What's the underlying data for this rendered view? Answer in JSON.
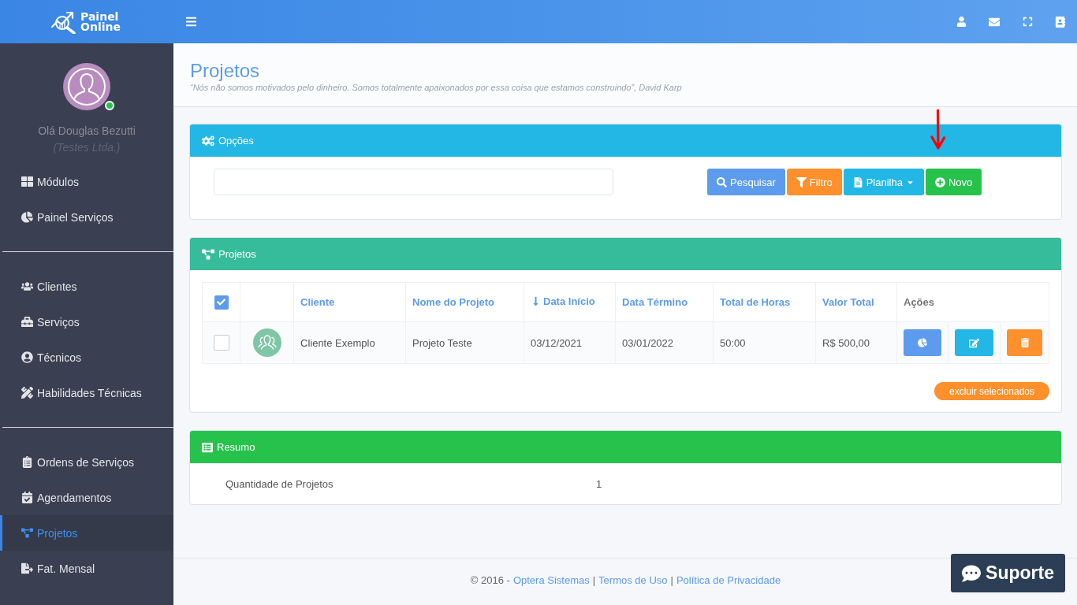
{
  "topbar": {
    "logo": [
      "Painel",
      "Online"
    ]
  },
  "sidebar": {
    "user": {
      "greeting": "Olá Douglas Bezutti",
      "company": "(Testes Ltda.)",
      "online": true
    },
    "groups": [
      [
        {
          "label": "Módulos",
          "selected": false
        },
        {
          "label": "Painel Serviços",
          "selected": false
        }
      ],
      [
        {
          "label": "Clientes",
          "selected": false
        },
        {
          "label": "Serviços",
          "selected": false
        },
        {
          "label": "Técnicos",
          "selected": false
        },
        {
          "label": "Habilidades Técnicas",
          "selected": false
        }
      ],
      [
        {
          "label": "Ordens de Serviços",
          "selected": false
        },
        {
          "label": "Agendamentos",
          "selected": false
        },
        {
          "label": "Projetos",
          "selected": true
        },
        {
          "label": "Fat. Mensal",
          "selected": false
        }
      ]
    ]
  },
  "page_header": {
    "title": "Projetos",
    "quote": "“Nós não somos motivados pelo dinheiro. Somos totalmente apaixonados por essa coisa que estamos construindo”, David Karp"
  },
  "options_panel": {
    "title": "Opções",
    "buttons": [
      {
        "label": "Pesquisar",
        "kind": "search"
      },
      {
        "label": "Filtro",
        "kind": "filter"
      },
      {
        "label": "Planilha",
        "kind": "menu"
      },
      {
        "label": "Novo",
        "kind": "new"
      }
    ]
  },
  "projects_panel": {
    "title": "Projetos",
    "table": {
      "all_checked": true,
      "columns": [
        {
          "label": "Cliente",
          "sortable": true,
          "sorted": false
        },
        {
          "label": "Nome do Projeto",
          "sortable": true,
          "sorted": false
        },
        {
          "label": "Data Início",
          "sortable": true,
          "sorted": true
        },
        {
          "label": "Data Término",
          "sortable": true,
          "sorted": false
        },
        {
          "label": "Total de Horas",
          "sortable": true,
          "sorted": false
        },
        {
          "label": "Valor Total",
          "sortable": true,
          "sorted": false
        },
        {
          "label": "Ações",
          "sortable": false,
          "sorted": false
        }
      ],
      "rows": [
        {
          "checked": false,
          "cells": [
            "Cliente Exemplo",
            "Projeto Teste",
            "03/12/2021",
            "03/01/2022",
            "50:00",
            "R$ 500,00"
          ]
        }
      ]
    },
    "delete_button": "excluir selecionados"
  },
  "summary_panel": {
    "title": "Resumo",
    "rows": [
      {
        "label": "Quantidade de Projetos",
        "value": "1"
      }
    ]
  },
  "footer": [
    {
      "kind": "text",
      "text": "© 2016 -"
    },
    {
      "kind": "link",
      "text": "Optera Sistemas"
    },
    {
      "kind": "text",
      "text": "|"
    },
    {
      "kind": "link",
      "text": "Termos de Uso"
    },
    {
      "kind": "text",
      "text": "|"
    },
    {
      "kind": "link",
      "text": "Política de Privacidade"
    }
  ],
  "support_button": {
    "label": "Suporte"
  }
}
